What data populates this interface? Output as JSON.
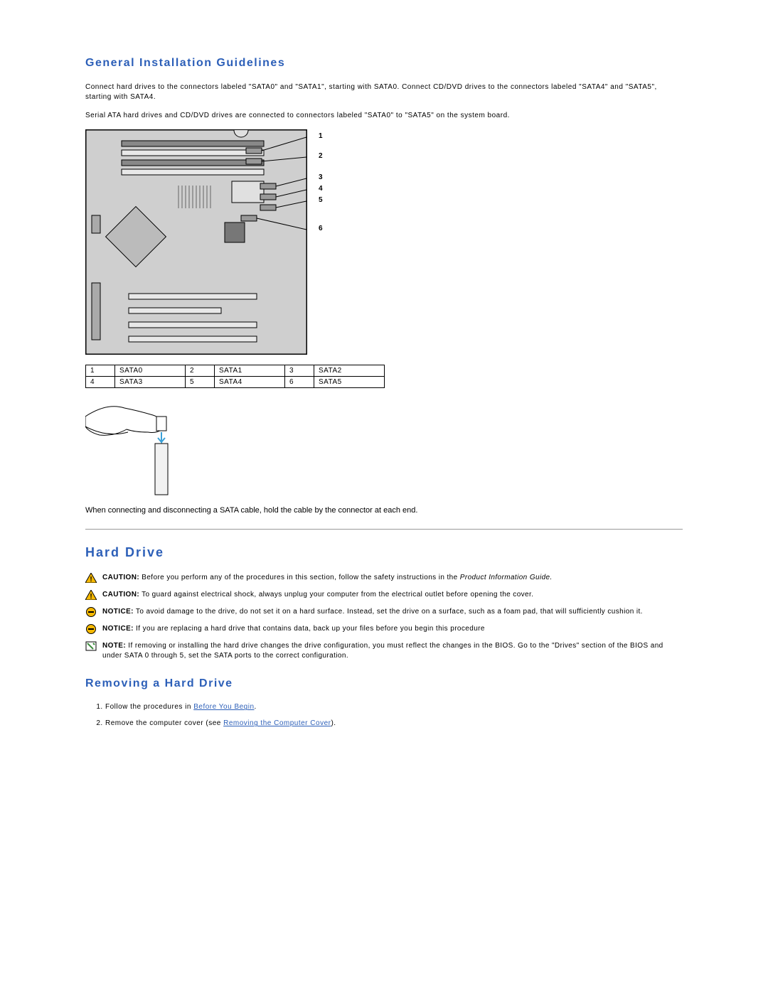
{
  "section1": {
    "title": "General Installation Guidelines",
    "p1": "Connect hard drives to the connectors labeled \"SATA0\" and \"SATA1\", starting with SATA0. Connect CD/DVD drives to the connectors labeled \"SATA4\" and \"SATA5\", starting with SATA4.",
    "p2": "Serial ATA hard drives and CD/DVD drives are connected to connectors labeled \"SATA0\" to \"SATA5\" on the system board."
  },
  "motherboard_labels": [
    "1",
    "2",
    "3",
    "4",
    "5",
    "6"
  ],
  "sata_table": {
    "rows": [
      {
        "n1": "1",
        "v1": "SATA0",
        "n2": "2",
        "v2": "SATA1",
        "n3": "3",
        "v3": "SATA2"
      },
      {
        "n1": "4",
        "v1": "SATA3",
        "n2": "5",
        "v2": "SATA4",
        "n3": "6",
        "v3": "SATA5"
      }
    ]
  },
  "cable_note": "When connecting and disconnecting a SATA cable, hold the cable by the connector at each end.",
  "section2": {
    "title": "Hard Drive",
    "caution1_lead": "CAUTION:",
    "caution1_text": " Before you perform any of the procedures in this section, follow the safety instructions in the ",
    "caution1_ital": "Product Information Guide.",
    "caution2_lead": "CAUTION:",
    "caution2_text": " To guard against electrical shock, always unplug your computer from the electrical outlet before opening the cover.",
    "notice1_lead": "NOTICE:",
    "notice1_text": " To avoid damage to the drive, do not set it on a hard surface. Instead, set the drive on a surface, such as a foam pad, that will sufficiently cushion it.",
    "notice2_lead": "NOTICE:",
    "notice2_text": " If you are replacing a hard drive that contains data, back up your files before you begin this procedure",
    "note_lead": "NOTE:",
    "note_text": " If removing or installing the hard drive changes the drive configuration, you must reflect the changes in the BIOS. Go to the \"Drives\" section of the BIOS and under SATA 0 through 5, set the SATA ports to the correct configuration."
  },
  "section3": {
    "title": "Removing a Hard Drive",
    "step1_pre": "Follow the procedures in ",
    "step1_link": "Before You Begin",
    "step1_post": ".",
    "step2_pre": "Remove the computer cover (see ",
    "step2_link": "Removing the Computer Cover",
    "step2_post": ")."
  }
}
